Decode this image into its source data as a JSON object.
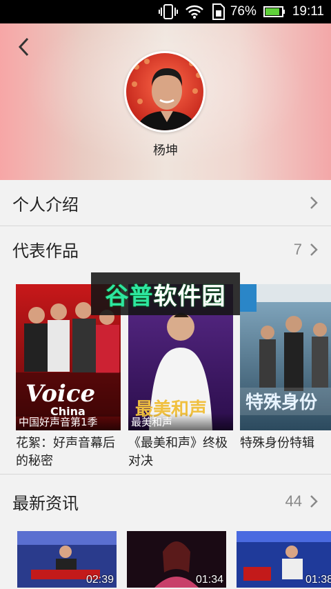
{
  "status_bar": {
    "battery_percent": "76%",
    "time": "19:11"
  },
  "header": {
    "artist_name": "杨坤"
  },
  "sections": {
    "intro": {
      "title": "个人介绍"
    },
    "works": {
      "title": "代表作品",
      "count": "7"
    },
    "news": {
      "title": "最新资讯",
      "count": "44"
    }
  },
  "works": [
    {
      "tag": "中国好声音第1季",
      "title": "花絮：好声音幕后的秘密"
    },
    {
      "tag": "最美和声",
      "title": "《最美和声》终极对决"
    },
    {
      "tag": "",
      "title": "特殊身份特辑"
    }
  ],
  "watermark": {
    "text_a": "谷普",
    "text_b": "软件园"
  },
  "news": [
    {
      "duration": "02:39"
    },
    {
      "duration": "01:34"
    },
    {
      "duration": "01:38"
    }
  ]
}
